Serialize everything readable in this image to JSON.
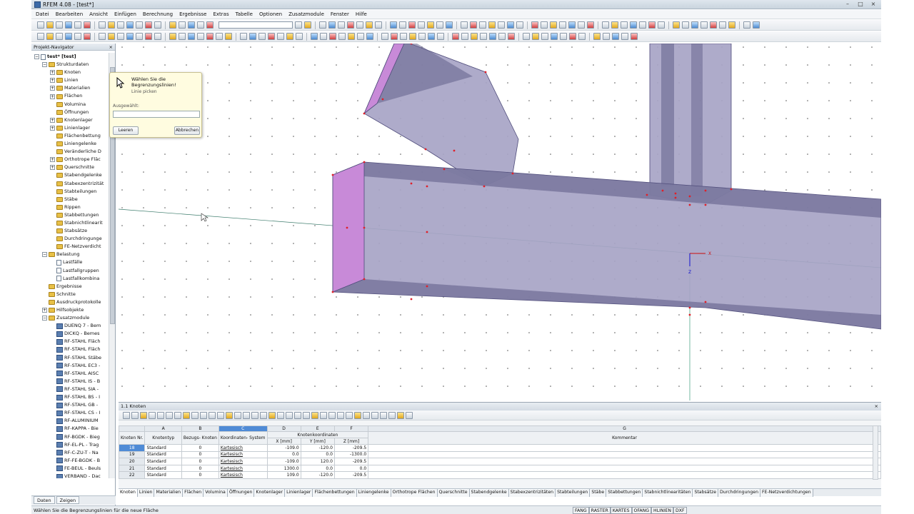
{
  "window": {
    "title": "RFEM 4.08 - [test*]",
    "min": "–",
    "max": "□",
    "close": "×"
  },
  "menu": [
    "Datei",
    "Bearbeiten",
    "Ansicht",
    "Einfügen",
    "Berechnung",
    "Ergebnisse",
    "Extras",
    "Tabelle",
    "Optionen",
    "Zusatzmodule",
    "Fenster",
    "Hilfe"
  ],
  "navigator": {
    "title": "Projekt-Navigator",
    "close": "× ",
    "tabs": [
      "Daten",
      "Zeigen"
    ],
    "items": [
      {
        "indent": 0,
        "exp": "−",
        "icon": "doc",
        "label": "test* [test]"
      },
      {
        "indent": 1,
        "exp": "−",
        "icon": "folder",
        "label": "Strukturdaten"
      },
      {
        "indent": 2,
        "exp": "+",
        "icon": "folder",
        "label": "Knoten"
      },
      {
        "indent": 2,
        "exp": "+",
        "icon": "folder",
        "label": "Linien"
      },
      {
        "indent": 2,
        "exp": "+",
        "icon": "folder",
        "label": "Materialien"
      },
      {
        "indent": 2,
        "exp": "+",
        "icon": "folder",
        "label": "Flächen"
      },
      {
        "indent": 2,
        "exp": "",
        "icon": "folder",
        "label": "Volumina"
      },
      {
        "indent": 2,
        "exp": "",
        "icon": "folder",
        "label": "Öffnungen"
      },
      {
        "indent": 2,
        "exp": "+",
        "icon": "folder",
        "label": "Knotenlager"
      },
      {
        "indent": 2,
        "exp": "+",
        "icon": "folder",
        "label": "Linienlager"
      },
      {
        "indent": 2,
        "exp": "",
        "icon": "folder",
        "label": "Flächenbettung"
      },
      {
        "indent": 2,
        "exp": "",
        "icon": "folder",
        "label": "Liniengelenke"
      },
      {
        "indent": 2,
        "exp": "",
        "icon": "folder",
        "label": "Veränderliche D"
      },
      {
        "indent": 2,
        "exp": "+",
        "icon": "folder",
        "label": "Orthotrope Fläc"
      },
      {
        "indent": 2,
        "exp": "+",
        "icon": "folder",
        "label": "Querschnitte"
      },
      {
        "indent": 2,
        "exp": "",
        "icon": "folder",
        "label": "Stabendgelenke"
      },
      {
        "indent": 2,
        "exp": "",
        "icon": "folder",
        "label": "Stabexzentrizität"
      },
      {
        "indent": 2,
        "exp": "",
        "icon": "folder",
        "label": "Stabteilungen"
      },
      {
        "indent": 2,
        "exp": "",
        "icon": "folder",
        "label": "Stäbe"
      },
      {
        "indent": 2,
        "exp": "",
        "icon": "folder",
        "label": "Rippen"
      },
      {
        "indent": 2,
        "exp": "",
        "icon": "folder",
        "label": "Stabbettungen"
      },
      {
        "indent": 2,
        "exp": "",
        "icon": "folder",
        "label": "Stabnichtlinearit"
      },
      {
        "indent": 2,
        "exp": "",
        "icon": "folder",
        "label": "Stabsätze"
      },
      {
        "indent": 2,
        "exp": "",
        "icon": "folder",
        "label": "Durchdringunge"
      },
      {
        "indent": 2,
        "exp": "",
        "icon": "folder",
        "label": "FE-Netzverdicht"
      },
      {
        "indent": 1,
        "exp": "−",
        "icon": "folder",
        "label": "Belastung"
      },
      {
        "indent": 2,
        "exp": "",
        "icon": "doc",
        "label": "Lastfälle"
      },
      {
        "indent": 2,
        "exp": "",
        "icon": "doc",
        "label": "Lastfallgruppen"
      },
      {
        "indent": 2,
        "exp": "",
        "icon": "doc",
        "label": "Lastfallkombina"
      },
      {
        "indent": 1,
        "exp": "",
        "icon": "folder",
        "label": "Ergebnisse"
      },
      {
        "indent": 1,
        "exp": "",
        "icon": "folder",
        "label": "Schnitte"
      },
      {
        "indent": 1,
        "exp": "",
        "icon": "folder",
        "label": "Ausdruckprotokolle"
      },
      {
        "indent": 1,
        "exp": "+",
        "icon": "folder",
        "label": "Hilfsobjekte"
      },
      {
        "indent": 1,
        "exp": "−",
        "icon": "folder",
        "label": "Zusatzmodule"
      },
      {
        "indent": 2,
        "exp": "",
        "icon": "mod",
        "label": "DUENQ 7 - Bem"
      },
      {
        "indent": 2,
        "exp": "",
        "icon": "mod",
        "label": "DICKQ - Bemes"
      },
      {
        "indent": 2,
        "exp": "",
        "icon": "mod",
        "label": "RF-STAHL Fläch"
      },
      {
        "indent": 2,
        "exp": "",
        "icon": "mod",
        "label": "RF-STAHL Fläch"
      },
      {
        "indent": 2,
        "exp": "",
        "icon": "mod",
        "label": "RF-STAHL Stäbe"
      },
      {
        "indent": 2,
        "exp": "",
        "icon": "mod",
        "label": "RF-STAHL EC3 -"
      },
      {
        "indent": 2,
        "exp": "",
        "icon": "mod",
        "label": "RF-STAHL AISC"
      },
      {
        "indent": 2,
        "exp": "",
        "icon": "mod",
        "label": "RF-STAHL IS - B"
      },
      {
        "indent": 2,
        "exp": "",
        "icon": "mod",
        "label": "RF-STAHL SIA -"
      },
      {
        "indent": 2,
        "exp": "",
        "icon": "mod",
        "label": "RF-STAHL BS - I"
      },
      {
        "indent": 2,
        "exp": "",
        "icon": "mod",
        "label": "RF-STAHL GB -"
      },
      {
        "indent": 2,
        "exp": "",
        "icon": "mod",
        "label": "RF-STAHL CS - I"
      },
      {
        "indent": 2,
        "exp": "",
        "icon": "mod",
        "label": "RF-ALUMINIUM"
      },
      {
        "indent": 2,
        "exp": "",
        "icon": "mod",
        "label": "RF-KAPPA - Bie"
      },
      {
        "indent": 2,
        "exp": "",
        "icon": "mod",
        "label": "RF-BGDK - Bieg"
      },
      {
        "indent": 2,
        "exp": "",
        "icon": "mod",
        "label": "RF-EL-PL - Trag"
      },
      {
        "indent": 2,
        "exp": "",
        "icon": "mod",
        "label": "RF-C-ZU-T - Na"
      },
      {
        "indent": 2,
        "exp": "",
        "icon": "mod",
        "label": "RF-FE-BGDK - B"
      },
      {
        "indent": 2,
        "exp": "",
        "icon": "mod",
        "label": "FE-BEUL - Beuls"
      },
      {
        "indent": 2,
        "exp": "",
        "icon": "mod",
        "label": "VERBAND - Dac"
      }
    ]
  },
  "dialog": {
    "line1": "Wählen Sie die Begrenzungslinien!",
    "line2": "Linie picken",
    "selected_label": "Ausgewählt:",
    "selected_value": "",
    "btn_clear": "Leeren",
    "btn_cancel": "Abbrechen"
  },
  "axes": {
    "x": "X",
    "z": "Z"
  },
  "table": {
    "title": "1.1 Knoten",
    "letters": [
      "",
      "A",
      "B",
      "C",
      "D",
      "E",
      "F",
      "G"
    ],
    "group_header": "Knotenkoordinaten",
    "headers": {
      "nr": "Knoten Nr.",
      "typ": "Knotentyp",
      "bezug": "Bezugs- Knoten",
      "ksys": "Koordinaten- System",
      "x": "X [mm]",
      "y": "Y [mm]",
      "z": "Z [mm]",
      "kommentar": "Kommentar"
    },
    "rows": [
      {
        "nr": "18",
        "typ": "Standard",
        "bezug": "0",
        "ksys": "Kartesisch",
        "x": "-109.0",
        "y": "-120.0",
        "z": "-209.5"
      },
      {
        "nr": "19",
        "typ": "Standard",
        "bezug": "0",
        "ksys": "Kartesisch",
        "x": "0.0",
        "y": "0.0",
        "z": "-1300.0"
      },
      {
        "nr": "20",
        "typ": "Standard",
        "bezug": "0",
        "ksys": "Kartesisch",
        "x": "-109.0",
        "y": "120.0",
        "z": "-209.5"
      },
      {
        "nr": "21",
        "typ": "Standard",
        "bezug": "0",
        "ksys": "Kartesisch",
        "x": "1300.0",
        "y": "0.0",
        "z": "0.0"
      },
      {
        "nr": "22",
        "typ": "Standard",
        "bezug": "0",
        "ksys": "Kartesisch",
        "x": "109.0",
        "y": "-120.0",
        "z": "-209.5"
      }
    ]
  },
  "bottom_tabs": [
    "Knoten",
    "Linien",
    "Materialien",
    "Flächen",
    "Volumina",
    "Öffnungen",
    "Knotenlager",
    "Linienlager",
    "Flächenbettungen",
    "Liniengelenke",
    "Orthotrope Flächen",
    "Querschnitte",
    "Stabendgelenke",
    "Stabexzentrizitäten",
    "Stabteilungen",
    "Stäbe",
    "Stabbettungen",
    "Stabnichtlinearitäten",
    "Stabsätze",
    "Durchdringungen",
    "FE-Netzverdichtungen"
  ],
  "status": {
    "message": "Wählen Sie die Begrenzungslinien für die neue Fläche",
    "flags": [
      "FANG",
      "RASTER",
      "KARTES",
      "OFANG",
      "HLINIEN",
      "DXF"
    ]
  },
  "colors": {
    "member_face": "#a7a4c6",
    "member_edge": "#4e4b7a",
    "member_dark": "#62608a",
    "end_face": "#c88ad8",
    "node": "#e0202a"
  }
}
